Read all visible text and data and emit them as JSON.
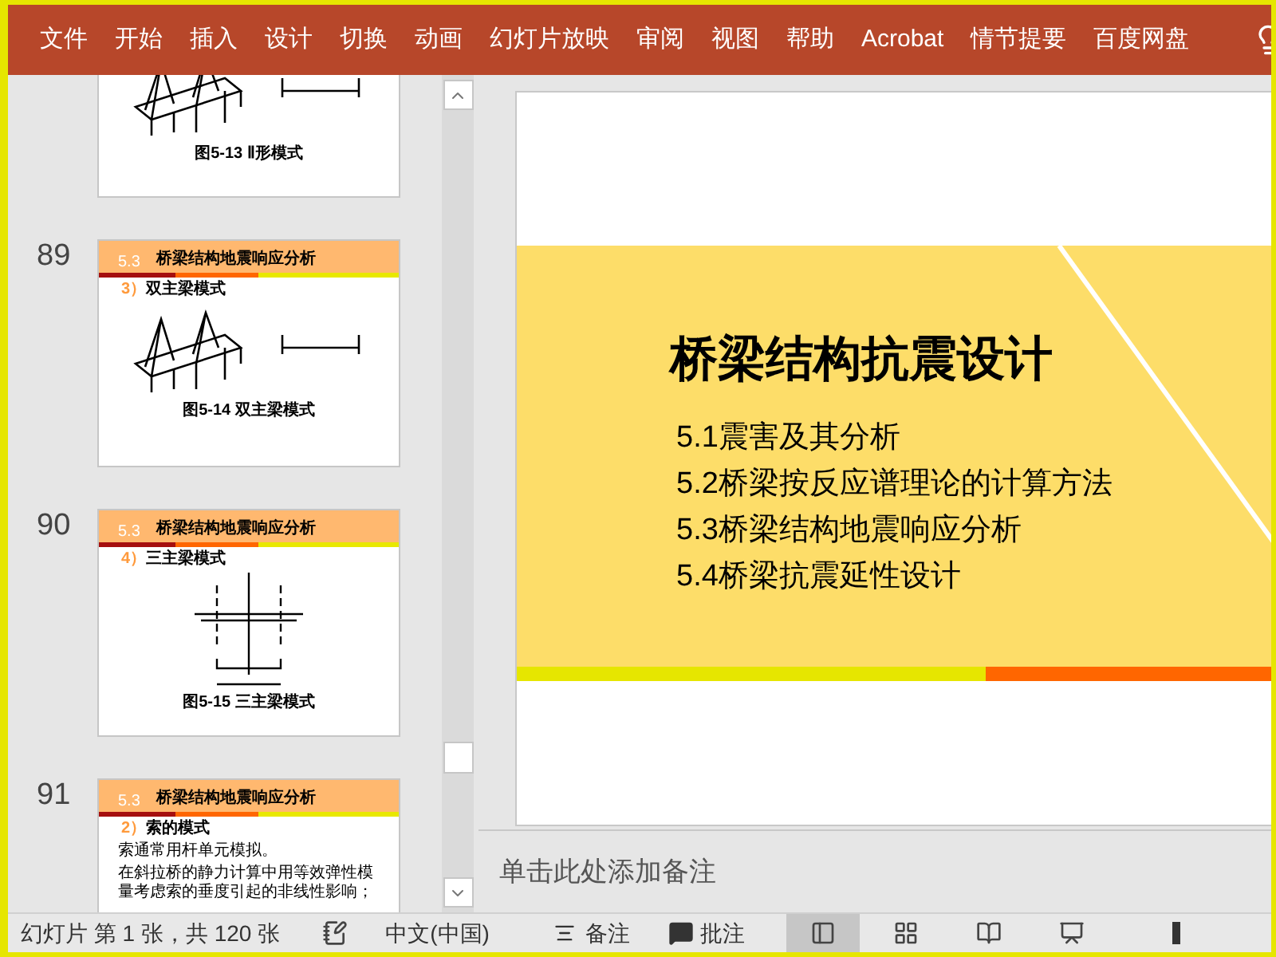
{
  "menu_bar": {
    "items": [
      "文件",
      "开始",
      "插入",
      "设计",
      "切换",
      "动画",
      "幻灯片放映",
      "审阅",
      "视图",
      "帮助",
      "Acrobat",
      "情节提要",
      "百度网盘"
    ]
  },
  "thumbnails": [
    {
      "kind": "bridge",
      "caption": "图5-13 Ⅱ形模式"
    },
    {
      "number": "89",
      "kind": "bridge",
      "section": "5.3",
      "header": "桥梁结构地震响应分析",
      "marker": "3）",
      "subtitle": "双主梁模式",
      "caption": "图5-14 双主梁模式"
    },
    {
      "number": "90",
      "kind": "cross",
      "section": "5.3",
      "header": "桥梁结构地震响应分析",
      "marker": "4）",
      "subtitle": "三主梁模式",
      "caption": "图5-15 三主梁模式"
    },
    {
      "number": "91",
      "kind": "text",
      "section": "5.3",
      "header": "桥梁结构地震响应分析",
      "marker": "2）",
      "subtitle": "索的模式",
      "paragraphs": [
        "索通常用杆单元模拟。",
        "在斜拉桥的静力计算中用等效弹性模量考虑索的垂度引起的非线性影响；"
      ]
    }
  ],
  "main_slide": {
    "title": "桥梁结构抗震设计",
    "items": [
      "5.1震害及其分析",
      "5.2桥梁按反应谱理论的计算方法",
      "5.3桥梁结构地震响应分析",
      "5.4桥梁抗震延性设计"
    ]
  },
  "notes": {
    "placeholder": "单击此处添加备注"
  },
  "status_bar": {
    "slide_info": "幻灯片 第 1 张，共 120 张",
    "language": "中文(中国)",
    "notes": "备注",
    "comments": "批注",
    "views": [
      {
        "kind": "normal",
        "selected": true
      },
      {
        "kind": "sorter",
        "selected": false
      },
      {
        "kind": "reading",
        "selected": false
      },
      {
        "kind": "slideshow",
        "selected": false
      }
    ]
  }
}
